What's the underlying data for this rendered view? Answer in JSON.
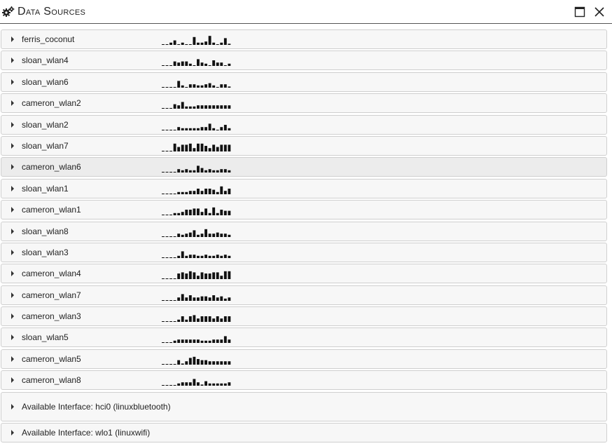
{
  "title": "Data Sources",
  "icons": {
    "title": "gears-icon",
    "maximize": "maximize-icon",
    "close": "close-icon"
  },
  "sources": [
    {
      "label": "ferris_coconut",
      "spark": [
        0,
        0,
        2,
        4,
        0,
        2,
        0,
        0,
        7,
        2,
        2,
        3,
        8,
        2,
        0,
        2,
        6,
        1
      ]
    },
    {
      "label": "sloan_wlan4",
      "spark": [
        0,
        0,
        0,
        4,
        3,
        4,
        4,
        2,
        0,
        6,
        3,
        2,
        0,
        5,
        3,
        3,
        0,
        2
      ]
    },
    {
      "label": "sloan_wlan6",
      "spark": [
        0,
        0,
        0,
        0,
        6,
        2,
        0,
        3,
        3,
        2,
        2,
        3,
        4,
        2,
        0,
        3,
        3,
        1
      ]
    },
    {
      "label": "cameron_wlan2",
      "spark": [
        0,
        0,
        0,
        4,
        3,
        6,
        2,
        2,
        2,
        3,
        3,
        3,
        3,
        3,
        3,
        3,
        3,
        3
      ]
    },
    {
      "label": "sloan_wlan2",
      "spark": [
        0,
        0,
        0,
        0,
        3,
        2,
        2,
        2,
        2,
        2,
        3,
        3,
        6,
        2,
        0,
        3,
        5,
        2
      ]
    },
    {
      "label": "sloan_wlan7",
      "spark": [
        0,
        0,
        0,
        7,
        4,
        6,
        6,
        7,
        3,
        7,
        7,
        5,
        3,
        6,
        4,
        6,
        6,
        6
      ]
    },
    {
      "label": "cameron_wlan6",
      "spark": [
        0,
        0,
        0,
        0,
        3,
        2,
        3,
        2,
        2,
        6,
        4,
        2,
        3,
        2,
        2,
        3,
        3,
        2
      ]
    },
    {
      "label": "sloan_wlan1",
      "spark": [
        0,
        0,
        0,
        0,
        2,
        2,
        2,
        3,
        3,
        5,
        3,
        5,
        5,
        4,
        2,
        7,
        3,
        5
      ]
    },
    {
      "label": "cameron_wlan1",
      "spark": [
        0,
        0,
        0,
        2,
        2,
        3,
        5,
        5,
        6,
        6,
        3,
        6,
        2,
        7,
        2,
        5,
        4,
        4
      ]
    },
    {
      "label": "sloan_wlan8",
      "spark": [
        0,
        0,
        0,
        0,
        3,
        2,
        3,
        4,
        6,
        2,
        3,
        7,
        3,
        3,
        4,
        3,
        3,
        2
      ]
    },
    {
      "label": "sloan_wlan3",
      "spark": [
        0,
        0,
        0,
        0,
        2,
        6,
        2,
        3,
        3,
        2,
        2,
        3,
        2,
        2,
        3,
        2,
        3,
        2
      ]
    },
    {
      "label": "cameron_wlan4",
      "spark": [
        0,
        0,
        0,
        0,
        5,
        6,
        5,
        7,
        6,
        3,
        6,
        5,
        5,
        6,
        6,
        3,
        7,
        7
      ]
    },
    {
      "label": "cameron_wlan7",
      "spark": [
        0,
        0,
        0,
        0,
        3,
        6,
        3,
        5,
        3,
        3,
        4,
        4,
        3,
        5,
        3,
        4,
        2,
        3
      ]
    },
    {
      "label": "cameron_wlan3",
      "spark": [
        0,
        0,
        0,
        0,
        2,
        5,
        2,
        5,
        6,
        3,
        5,
        5,
        5,
        3,
        5,
        3,
        5,
        5
      ]
    },
    {
      "label": "sloan_wlan5",
      "spark": [
        0,
        0,
        0,
        2,
        3,
        3,
        3,
        3,
        3,
        3,
        2,
        2,
        2,
        3,
        3,
        3,
        6,
        3
      ]
    },
    {
      "label": "cameron_wlan5",
      "spark": [
        0,
        0,
        0,
        0,
        4,
        1,
        3,
        6,
        7,
        5,
        4,
        4,
        3,
        3,
        3,
        3,
        3,
        3
      ]
    },
    {
      "label": "cameron_wlan8",
      "spark": [
        0,
        0,
        0,
        0,
        2,
        3,
        3,
        3,
        6,
        3,
        1,
        4,
        2,
        2,
        2,
        2,
        2,
        3
      ]
    }
  ],
  "interfaces": [
    {
      "label": "Available Interface: hci0 (linuxbluetooth)"
    },
    {
      "label": "Available Interface: wlo1 (linuxwifi)"
    }
  ]
}
